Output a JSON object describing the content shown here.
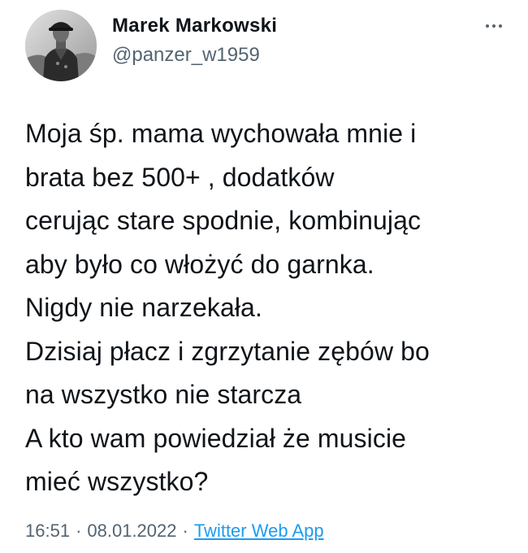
{
  "author": {
    "name": "Marek  Markowski",
    "handle": "@panzer_w1959",
    "avatar": "avatar-photo"
  },
  "more_icon": "more-horizontal-icon",
  "tweet": {
    "lines": [
      "Moja śp. mama wychowała mnie i",
      "brata bez 500+ , dodatków",
      "cerując stare spodnie, kombinując",
      "aby było co włożyć do garnka.",
      "Nigdy nie narzekała.",
      "Dzisiaj płacz i zgrzytanie zębów bo",
      "na wszystko nie starcza",
      "A kto wam powiedział że musicie",
      "mieć wszystko?"
    ]
  },
  "meta": {
    "time": "16:51",
    "separator": "·",
    "date": "08.01.2022",
    "source": "Twitter Web App"
  },
  "colors": {
    "text": "#0f1419",
    "secondary": "#536471",
    "link": "#1d9bf0"
  }
}
